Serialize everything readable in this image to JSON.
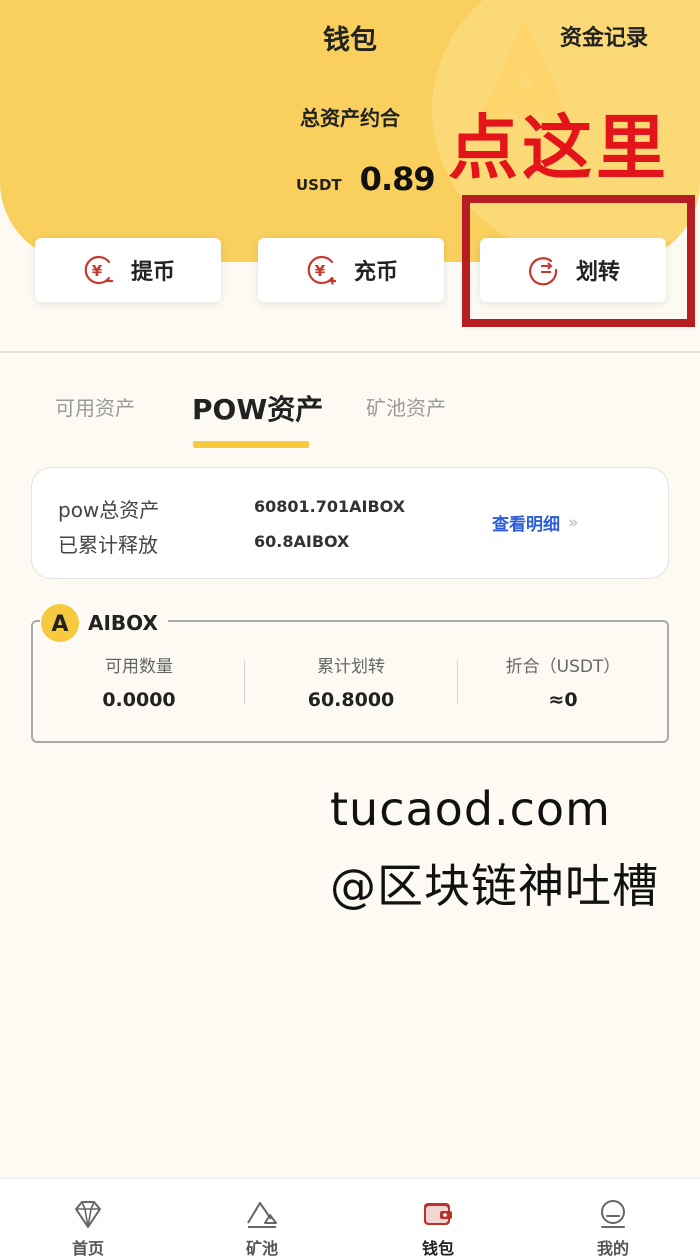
{
  "header": {
    "title": "钱包",
    "records_label": "资金记录",
    "total_label": "总资产约合",
    "currency": "USDT",
    "total_value": "0.89"
  },
  "actions": [
    {
      "label": "提币",
      "icon": "yen-minus-icon"
    },
    {
      "label": "充币",
      "icon": "yen-plus-icon"
    },
    {
      "label": "划转",
      "icon": "transfer-icon"
    }
  ],
  "annotation": {
    "text": "点这里",
    "color": "#e3151b"
  },
  "tabs": [
    {
      "label": "可用资产",
      "active": false
    },
    {
      "label": "POW资产",
      "active": true
    },
    {
      "label": "矿池资产",
      "active": false
    }
  ],
  "summary": {
    "total_label": "pow总资产",
    "total_value": "60801.701AIBOX",
    "released_label": "已累计释放",
    "released_value": "60.8AIBOX",
    "detail_label": "查看明细",
    "detail_chevron": "»"
  },
  "coin": {
    "name": "AIBOX",
    "badge_letter": "A",
    "stats": [
      {
        "label": "可用数量",
        "value": "0.0000"
      },
      {
        "label": "累计划转",
        "value": "60.8000"
      },
      {
        "label": "折合（USDT）",
        "value": "≈0"
      }
    ]
  },
  "watermark": {
    "line1": "tucaod.com",
    "line2": "@区块链神吐槽"
  },
  "nav": [
    {
      "label": "首页",
      "icon": "diamond-icon",
      "active": false
    },
    {
      "label": "矿池",
      "icon": "mountain-icon",
      "active": false
    },
    {
      "label": "钱包",
      "icon": "wallet-icon",
      "active": true
    },
    {
      "label": "我的",
      "icon": "profile-icon",
      "active": false
    }
  ],
  "colors": {
    "brand_yellow": "#f9cf5d",
    "link_blue": "#2d5ed8",
    "accent_red": "#e3151b"
  }
}
